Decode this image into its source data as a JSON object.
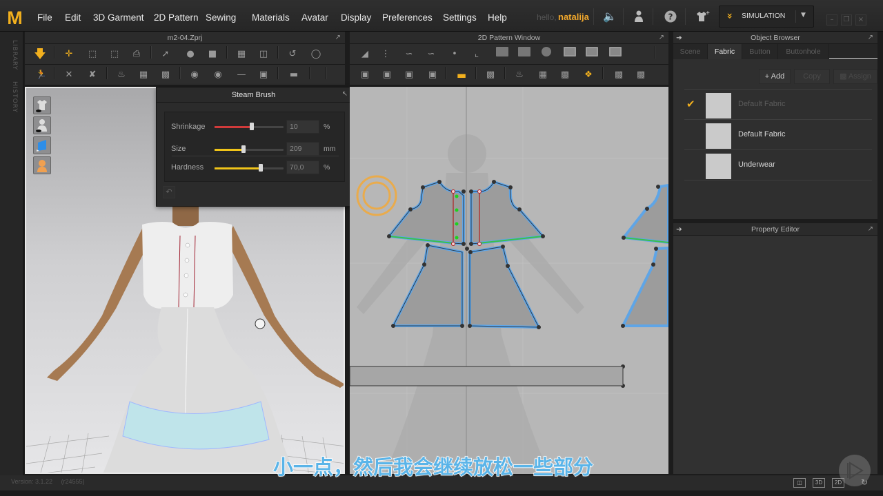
{
  "app": {
    "logo": "M",
    "menu": [
      "File",
      "Edit",
      "3D Garment",
      "2D Pattern",
      "Sewing",
      "Materials",
      "Avatar",
      "Display",
      "Preferences",
      "Settings",
      "Help"
    ],
    "greeting": "hello,",
    "username": "natalija",
    "mode": "SIMULATION",
    "accent_color": "#f2b01e"
  },
  "side_tabs": [
    "LIBRARY",
    "HISTORY"
  ],
  "viewport3d": {
    "title": "m2-04.Zprj"
  },
  "steam_brush": {
    "title": "Steam Brush",
    "params": [
      {
        "label": "Shrinkage",
        "value": "10",
        "unit": "%",
        "fraction": 0.54,
        "color": "#d03a3a"
      },
      {
        "label": "Size",
        "value": "209",
        "unit": "mm",
        "fraction": 0.42,
        "color": "#f0c419"
      },
      {
        "label": "Hardness",
        "value": "70,0",
        "unit": "%",
        "fraction": 0.67,
        "color": "#f0c419"
      }
    ]
  },
  "pattern2d": {
    "title": "2D Pattern Window"
  },
  "object_browser": {
    "title": "Object Browser",
    "tabs": [
      "Scene",
      "Fabric",
      "Button",
      "Buttonhole"
    ],
    "active_tab": "Fabric",
    "buttons": {
      "add": "Add",
      "copy": "Copy",
      "assign": "Assign"
    },
    "fabrics": [
      {
        "name": "Default Fabric",
        "checked": true
      },
      {
        "name": "Default Fabric",
        "checked": false
      },
      {
        "name": "Underwear",
        "checked": false
      }
    ]
  },
  "property_editor": {
    "title": "Property Editor"
  },
  "status": {
    "version": "Version: 3.1.22",
    "build": "(r24555)",
    "view_modes": [
      "",
      "3D",
      "2D"
    ]
  },
  "subtitle": "小一点，然后我会继续放松一些部分"
}
